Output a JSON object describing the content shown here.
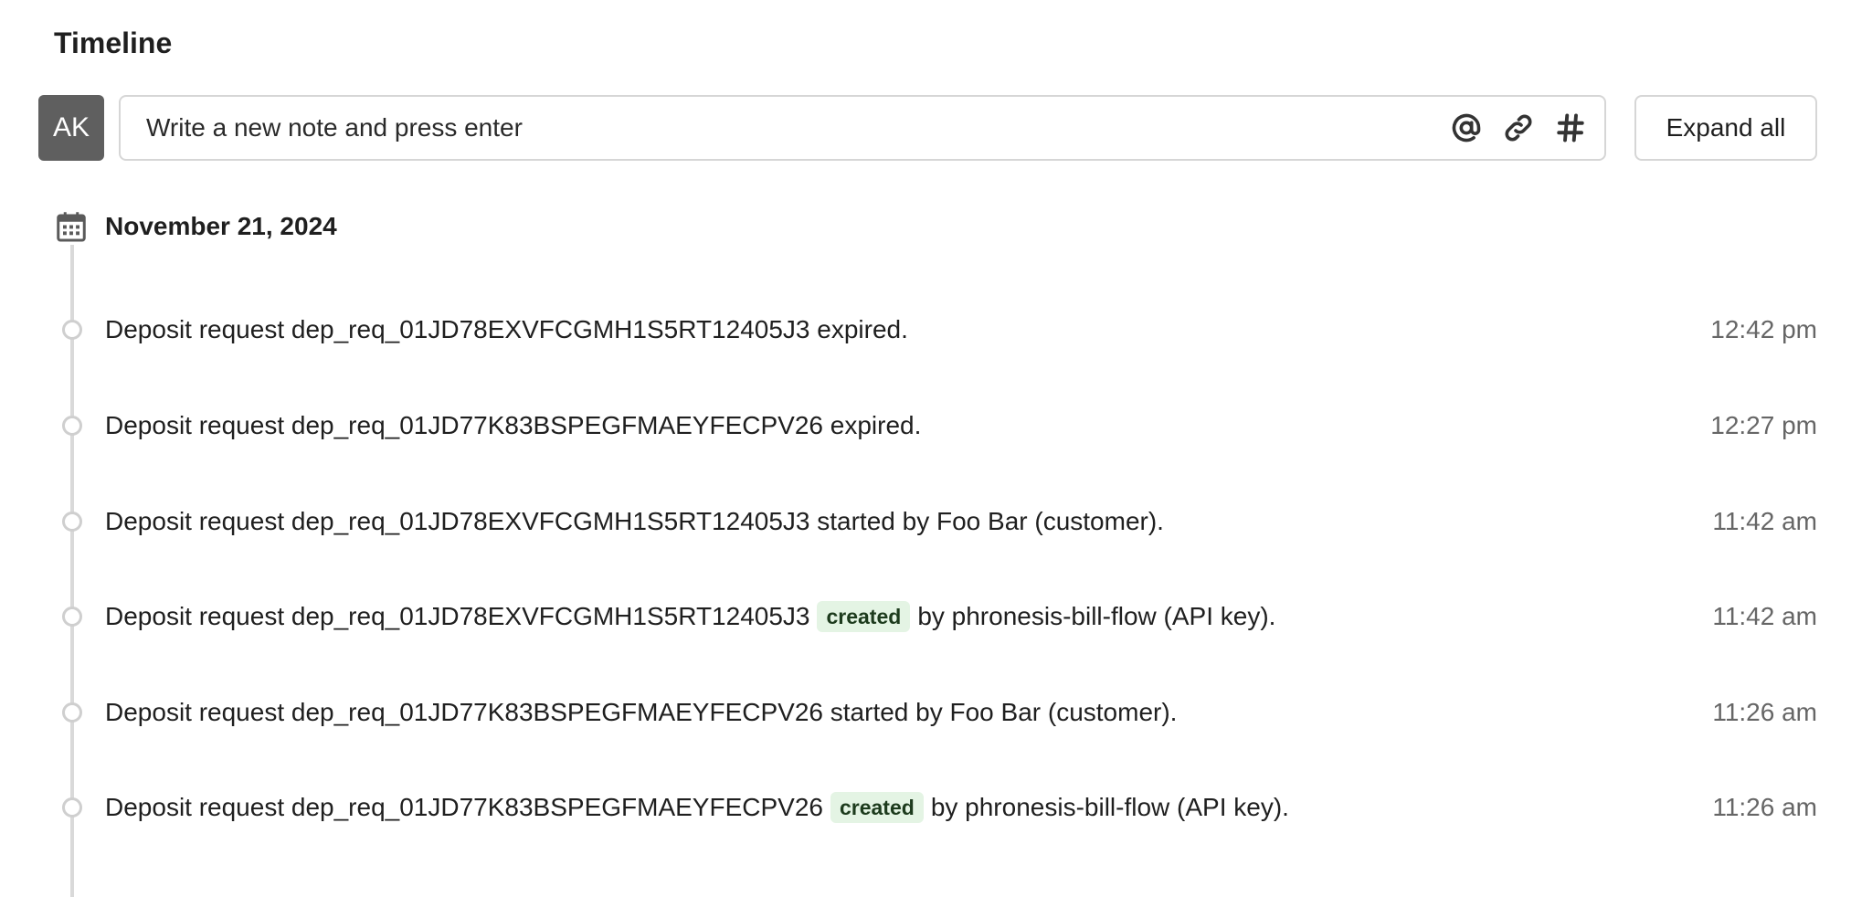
{
  "timeline": {
    "title": "Timeline",
    "avatar_initials": "AK",
    "note_placeholder": "Write a new note and press enter",
    "expand_all_label": "Expand all",
    "date": "November 21, 2024",
    "events": [
      {
        "prefix": "Deposit request dep_req_01JD78EXVFCGMH1S5RT12405J3 expired.",
        "badge": "",
        "suffix": "",
        "time": "12:42 pm"
      },
      {
        "prefix": "Deposit request dep_req_01JD77K83BSPEGFMAEYFECPV26 expired.",
        "badge": "",
        "suffix": "",
        "time": "12:27 pm"
      },
      {
        "prefix": "Deposit request dep_req_01JD78EXVFCGMH1S5RT12405J3 started by Foo Bar (customer).",
        "badge": "",
        "suffix": "",
        "time": "11:42 am"
      },
      {
        "prefix": "Deposit request dep_req_01JD78EXVFCGMH1S5RT12405J3",
        "badge": "created",
        "suffix": "by phronesis-bill-flow (API key).",
        "time": "11:42 am"
      },
      {
        "prefix": "Deposit request dep_req_01JD77K83BSPEGFMAEYFECPV26 started by Foo Bar (customer).",
        "badge": "",
        "suffix": "",
        "time": "11:26 am"
      },
      {
        "prefix": "Deposit request dep_req_01JD77K83BSPEGFMAEYFECPV26",
        "badge": "created",
        "suffix": "by phronesis-bill-flow (API key).",
        "time": "11:26 am"
      }
    ]
  },
  "icons": {
    "mention": "at-sign-icon",
    "attach": "paperclip-icon",
    "tag": "hashtag-icon",
    "date": "calendar-icon",
    "event": "timeline-dot-icon"
  },
  "colors": {
    "avatar_bg": "#5f5f5f",
    "badge_bg": "#e4f4e4",
    "border": "#d6d6d6",
    "rail": "#d9d9d9",
    "time_text": "#666666"
  }
}
